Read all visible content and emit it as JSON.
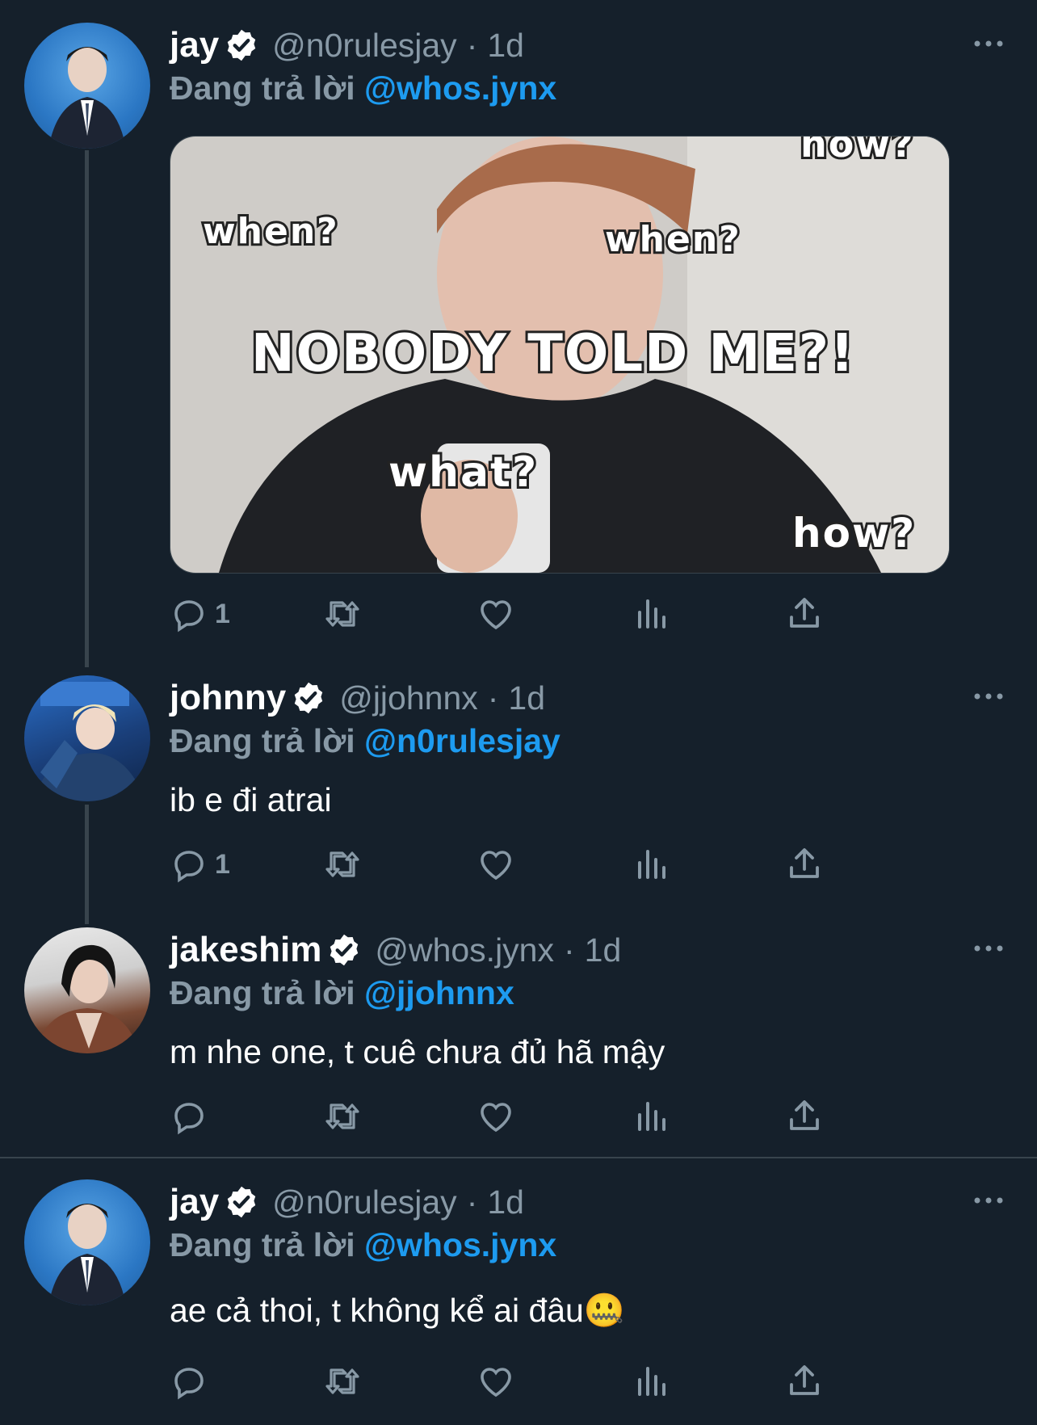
{
  "colors": {
    "background": "#15202b",
    "text": "#ffffff",
    "muted": "#8899a6",
    "accent": "#1d9bf0",
    "divider": "#38444d"
  },
  "tweets": [
    {
      "display_name": "jay",
      "handle": "@n0rulesjay",
      "separator": "·",
      "time": "1d",
      "reply_prefix": "Đang trả lời",
      "reply_to": "@whos.jynx",
      "text": "",
      "reply_count": "1",
      "media": {
        "captions": [
          "now?",
          "when?",
          "when?",
          "NOBODY TOLD ME?!",
          "what?",
          "how?"
        ]
      }
    },
    {
      "display_name": "johnny",
      "handle": "@jjohnnx",
      "separator": "·",
      "time": "1d",
      "reply_prefix": "Đang trả lời",
      "reply_to": "@n0rulesjay",
      "text": "ib e đi atrai",
      "reply_count": "1"
    },
    {
      "display_name": "jakeshim",
      "handle": "@whos.jynx",
      "separator": "·",
      "time": "1d",
      "reply_prefix": "Đang trả lời",
      "reply_to": "@jjohnnx",
      "text": "m nhe one, t cuê chưa đủ hã mậy",
      "reply_count": ""
    },
    {
      "display_name": "jay",
      "handle": "@n0rulesjay",
      "separator": "·",
      "time": "1d",
      "reply_prefix": "Đang trả lời",
      "reply_to": "@whos.jynx",
      "text": "ae cả thoi, t không kể ai đâu🤐",
      "reply_count": ""
    }
  ],
  "icons": [
    "reply-icon",
    "retweet-icon",
    "like-icon",
    "views-icon",
    "share-icon",
    "verified-icon",
    "more-icon"
  ]
}
